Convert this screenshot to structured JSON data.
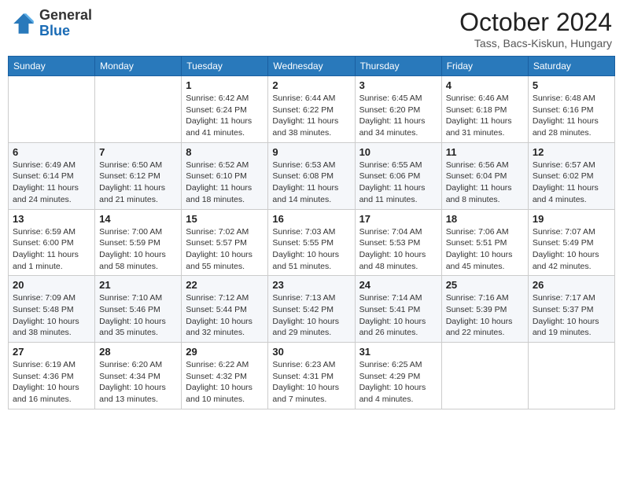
{
  "header": {
    "logo_general": "General",
    "logo_blue": "Blue",
    "month": "October 2024",
    "location": "Tass, Bacs-Kiskun, Hungary"
  },
  "weekdays": [
    "Sunday",
    "Monday",
    "Tuesday",
    "Wednesday",
    "Thursday",
    "Friday",
    "Saturday"
  ],
  "weeks": [
    [
      {
        "day": "",
        "detail": ""
      },
      {
        "day": "",
        "detail": ""
      },
      {
        "day": "1",
        "detail": "Sunrise: 6:42 AM\nSunset: 6:24 PM\nDaylight: 11 hours and 41 minutes."
      },
      {
        "day": "2",
        "detail": "Sunrise: 6:44 AM\nSunset: 6:22 PM\nDaylight: 11 hours and 38 minutes."
      },
      {
        "day": "3",
        "detail": "Sunrise: 6:45 AM\nSunset: 6:20 PM\nDaylight: 11 hours and 34 minutes."
      },
      {
        "day": "4",
        "detail": "Sunrise: 6:46 AM\nSunset: 6:18 PM\nDaylight: 11 hours and 31 minutes."
      },
      {
        "day": "5",
        "detail": "Sunrise: 6:48 AM\nSunset: 6:16 PM\nDaylight: 11 hours and 28 minutes."
      }
    ],
    [
      {
        "day": "6",
        "detail": "Sunrise: 6:49 AM\nSunset: 6:14 PM\nDaylight: 11 hours and 24 minutes."
      },
      {
        "day": "7",
        "detail": "Sunrise: 6:50 AM\nSunset: 6:12 PM\nDaylight: 11 hours and 21 minutes."
      },
      {
        "day": "8",
        "detail": "Sunrise: 6:52 AM\nSunset: 6:10 PM\nDaylight: 11 hours and 18 minutes."
      },
      {
        "day": "9",
        "detail": "Sunrise: 6:53 AM\nSunset: 6:08 PM\nDaylight: 11 hours and 14 minutes."
      },
      {
        "day": "10",
        "detail": "Sunrise: 6:55 AM\nSunset: 6:06 PM\nDaylight: 11 hours and 11 minutes."
      },
      {
        "day": "11",
        "detail": "Sunrise: 6:56 AM\nSunset: 6:04 PM\nDaylight: 11 hours and 8 minutes."
      },
      {
        "day": "12",
        "detail": "Sunrise: 6:57 AM\nSunset: 6:02 PM\nDaylight: 11 hours and 4 minutes."
      }
    ],
    [
      {
        "day": "13",
        "detail": "Sunrise: 6:59 AM\nSunset: 6:00 PM\nDaylight: 11 hours and 1 minute."
      },
      {
        "day": "14",
        "detail": "Sunrise: 7:00 AM\nSunset: 5:59 PM\nDaylight: 10 hours and 58 minutes."
      },
      {
        "day": "15",
        "detail": "Sunrise: 7:02 AM\nSunset: 5:57 PM\nDaylight: 10 hours and 55 minutes."
      },
      {
        "day": "16",
        "detail": "Sunrise: 7:03 AM\nSunset: 5:55 PM\nDaylight: 10 hours and 51 minutes."
      },
      {
        "day": "17",
        "detail": "Sunrise: 7:04 AM\nSunset: 5:53 PM\nDaylight: 10 hours and 48 minutes."
      },
      {
        "day": "18",
        "detail": "Sunrise: 7:06 AM\nSunset: 5:51 PM\nDaylight: 10 hours and 45 minutes."
      },
      {
        "day": "19",
        "detail": "Sunrise: 7:07 AM\nSunset: 5:49 PM\nDaylight: 10 hours and 42 minutes."
      }
    ],
    [
      {
        "day": "20",
        "detail": "Sunrise: 7:09 AM\nSunset: 5:48 PM\nDaylight: 10 hours and 38 minutes."
      },
      {
        "day": "21",
        "detail": "Sunrise: 7:10 AM\nSunset: 5:46 PM\nDaylight: 10 hours and 35 minutes."
      },
      {
        "day": "22",
        "detail": "Sunrise: 7:12 AM\nSunset: 5:44 PM\nDaylight: 10 hours and 32 minutes."
      },
      {
        "day": "23",
        "detail": "Sunrise: 7:13 AM\nSunset: 5:42 PM\nDaylight: 10 hours and 29 minutes."
      },
      {
        "day": "24",
        "detail": "Sunrise: 7:14 AM\nSunset: 5:41 PM\nDaylight: 10 hours and 26 minutes."
      },
      {
        "day": "25",
        "detail": "Sunrise: 7:16 AM\nSunset: 5:39 PM\nDaylight: 10 hours and 22 minutes."
      },
      {
        "day": "26",
        "detail": "Sunrise: 7:17 AM\nSunset: 5:37 PM\nDaylight: 10 hours and 19 minutes."
      }
    ],
    [
      {
        "day": "27",
        "detail": "Sunrise: 6:19 AM\nSunset: 4:36 PM\nDaylight: 10 hours and 16 minutes."
      },
      {
        "day": "28",
        "detail": "Sunrise: 6:20 AM\nSunset: 4:34 PM\nDaylight: 10 hours and 13 minutes."
      },
      {
        "day": "29",
        "detail": "Sunrise: 6:22 AM\nSunset: 4:32 PM\nDaylight: 10 hours and 10 minutes."
      },
      {
        "day": "30",
        "detail": "Sunrise: 6:23 AM\nSunset: 4:31 PM\nDaylight: 10 hours and 7 minutes."
      },
      {
        "day": "31",
        "detail": "Sunrise: 6:25 AM\nSunset: 4:29 PM\nDaylight: 10 hours and 4 minutes."
      },
      {
        "day": "",
        "detail": ""
      },
      {
        "day": "",
        "detail": ""
      }
    ]
  ]
}
